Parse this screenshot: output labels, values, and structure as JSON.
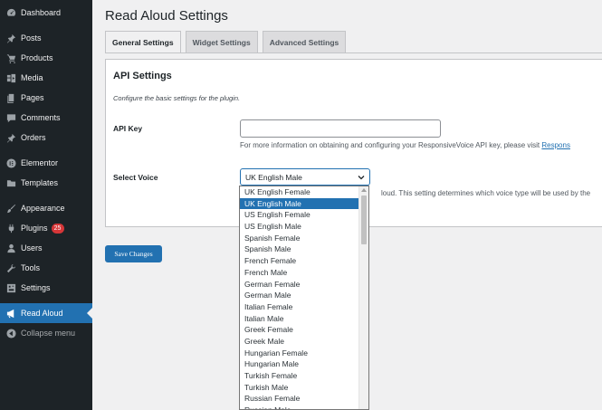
{
  "sidebar": {
    "items": [
      {
        "label": "Dashboard",
        "icon": "dashboard-icon"
      },
      {
        "label": "Posts",
        "icon": "pin-icon"
      },
      {
        "label": "Products",
        "icon": "cart-icon"
      },
      {
        "label": "Media",
        "icon": "media-icon"
      },
      {
        "label": "Pages",
        "icon": "pages-icon"
      },
      {
        "label": "Comments",
        "icon": "comment-icon"
      },
      {
        "label": "Orders",
        "icon": "pin-icon"
      },
      {
        "label": "Elementor",
        "icon": "elementor-icon"
      },
      {
        "label": "Templates",
        "icon": "folder-icon"
      },
      {
        "label": "Appearance",
        "icon": "brush-icon"
      },
      {
        "label": "Plugins",
        "icon": "plug-icon",
        "badge": "25"
      },
      {
        "label": "Users",
        "icon": "user-icon"
      },
      {
        "label": "Tools",
        "icon": "wrench-icon"
      },
      {
        "label": "Settings",
        "icon": "settings-icon"
      },
      {
        "label": "Read Aloud",
        "icon": "megaphone-icon"
      },
      {
        "label": "Collapse menu",
        "icon": "collapse-icon"
      }
    ]
  },
  "page": {
    "title": "Read Aloud Settings",
    "tabs": [
      {
        "label": "General Settings"
      },
      {
        "label": "Widget Settings"
      },
      {
        "label": "Advanced Settings"
      }
    ]
  },
  "api": {
    "heading": "API Settings",
    "description": "Configure the basic settings for the plugin.",
    "key_label": "API Key",
    "key_value": "",
    "key_help": "For more information on obtaining and configuring your ResponsiveVoice API key, please visit ",
    "key_help_link": "Respons",
    "voice_label": "Select Voice",
    "voice_selected": "UK English Male",
    "voice_help": "loud. This setting determines which voice type will be used by the"
  },
  "save_label": "Save Changes",
  "voices": [
    "UK English Female",
    "UK English Male",
    "US English Female",
    "US English Male",
    "Spanish Female",
    "Spanish Male",
    "French Female",
    "French Male",
    "German Female",
    "German Male",
    "Italian Female",
    "Italian Male",
    "Greek Female",
    "Greek Male",
    "Hungarian Female",
    "Hungarian Male",
    "Turkish Female",
    "Turkish Male",
    "Russian Female",
    "Russian Male"
  ],
  "colors": {
    "sidebar_bg": "#1d2327",
    "accent": "#2271b1",
    "badge": "#d63638"
  }
}
